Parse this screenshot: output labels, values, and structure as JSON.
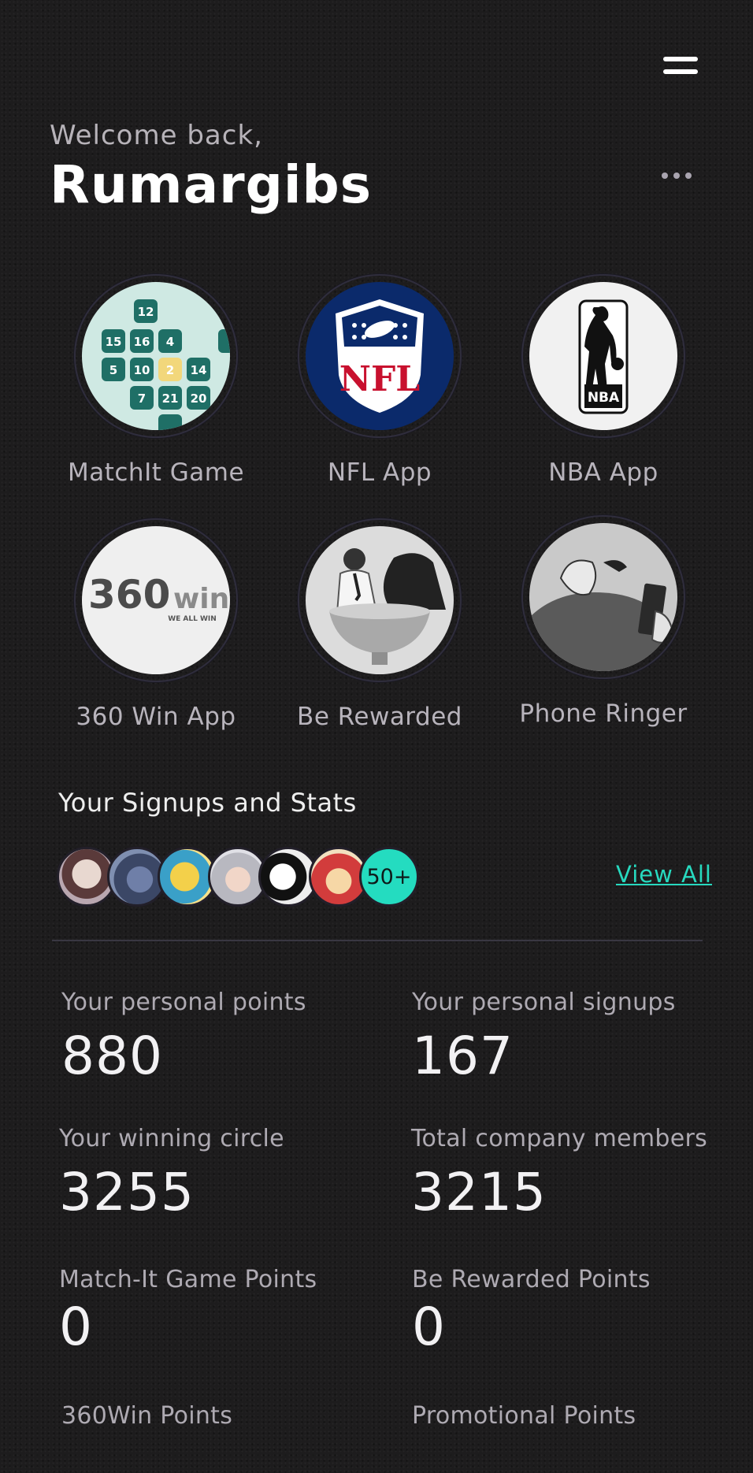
{
  "header": {
    "welcome": "Welcome back,",
    "username": "Rumargibs"
  },
  "apps": [
    {
      "label": "MatchIt Game",
      "icon": "matchit-icon"
    },
    {
      "label": "NFL App",
      "icon": "nfl-logo-icon"
    },
    {
      "label": "NBA App",
      "icon": "nba-logo-icon"
    },
    {
      "label": "360 Win App",
      "icon": "360win-logo-icon"
    },
    {
      "label": "Be Rewarded",
      "icon": "be-rewarded-icon"
    },
    {
      "label": "Phone Ringer",
      "icon": "phone-ringer-icon"
    }
  ],
  "matchit_tiles": [
    "12",
    "15",
    "16",
    "4",
    "5",
    "10",
    "2",
    "14",
    "7",
    "21",
    "20"
  ],
  "nfl_text": "NFL",
  "nba_text": "NBA",
  "win360": {
    "num": "360",
    "word": "win",
    "tagline": "WE ALL WIN"
  },
  "signups": {
    "title": "Your Signups and Stats",
    "more_count": "50+",
    "view_all": "View All"
  },
  "stats": [
    {
      "label": "Your personal points",
      "value": "880"
    },
    {
      "label": "Your personal signups",
      "value": "167"
    },
    {
      "label": "Your winning circle",
      "value": "3255"
    },
    {
      "label": "Total company members",
      "value": "3215"
    },
    {
      "label": "Match-It Game Points",
      "value": "0"
    },
    {
      "label": "Be Rewarded Points",
      "value": "0"
    },
    {
      "label": "360Win Points",
      "value": ""
    },
    {
      "label": "Promotional Points",
      "value": ""
    }
  ],
  "colors": {
    "background": "#1d1c1d",
    "accent": "#24dcc0",
    "nfl_blue": "#0b2a6b",
    "nfl_red": "#c8102e"
  }
}
